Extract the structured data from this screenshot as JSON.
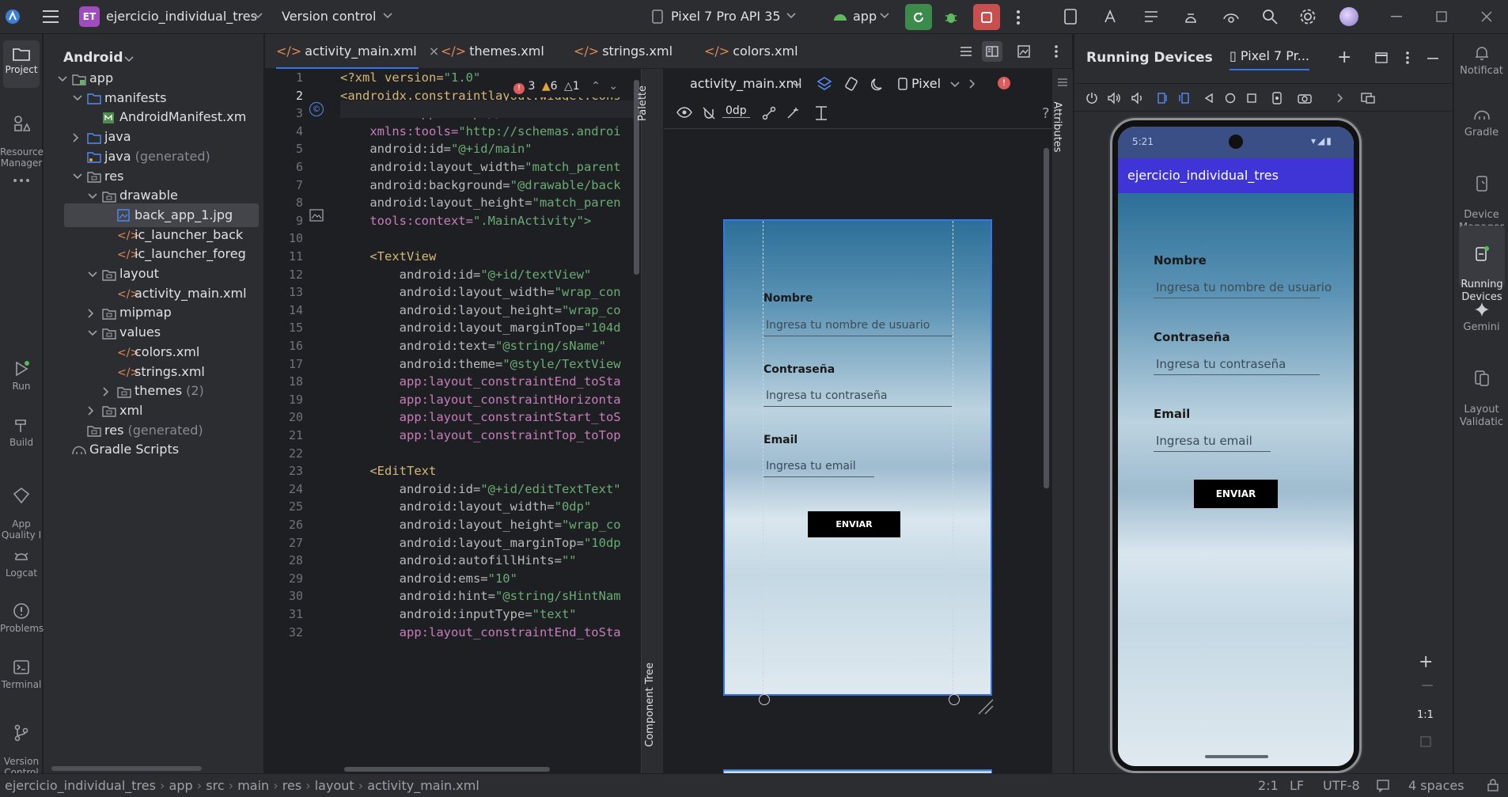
{
  "titlebar": {
    "project_badge": "ET",
    "project_name": "ejercicio_individual_tres",
    "vcs": "Version control",
    "device": "Pixel 7 Pro API 35",
    "run_config": "app"
  },
  "left_stripe": [
    {
      "label": "Project"
    },
    {
      "label": "Resource\nManager"
    },
    {
      "label": "Run"
    },
    {
      "label": "Build"
    },
    {
      "label": "App\nQuality I"
    },
    {
      "label": "Logcat"
    },
    {
      "label": "Problems"
    },
    {
      "label": "Terminal"
    },
    {
      "label": "Version\nControl"
    }
  ],
  "project_panel": {
    "view": "Android",
    "tree": [
      {
        "label": "app",
        "extra": ""
      },
      {
        "label": "manifests",
        "extra": ""
      },
      {
        "label": "AndroidManifest.xm",
        "extra": ""
      },
      {
        "label": "java",
        "extra": ""
      },
      {
        "label": "java",
        "extra": "(generated)"
      },
      {
        "label": "res",
        "extra": ""
      },
      {
        "label": "drawable",
        "extra": ""
      },
      {
        "label": "back_app_1.jpg",
        "extra": ""
      },
      {
        "label": "ic_launcher_back",
        "extra": ""
      },
      {
        "label": "ic_launcher_foreg",
        "extra": ""
      },
      {
        "label": "layout",
        "extra": ""
      },
      {
        "label": "activity_main.xml",
        "extra": ""
      },
      {
        "label": "mipmap",
        "extra": ""
      },
      {
        "label": "values",
        "extra": ""
      },
      {
        "label": "colors.xml",
        "extra": ""
      },
      {
        "label": "strings.xml",
        "extra": ""
      },
      {
        "label": "themes",
        "extra": "(2)"
      },
      {
        "label": "xml",
        "extra": ""
      },
      {
        "label": "res",
        "extra": "(generated)"
      },
      {
        "label": "Gradle Scripts",
        "extra": ""
      }
    ]
  },
  "tabs": [
    "activity_main.xml",
    "themes.xml",
    "strings.xml",
    "colors.xml"
  ],
  "inspections": {
    "errors": "3",
    "warnings": "6",
    "weak": "1"
  },
  "code_lines": [
    "1",
    "2",
    "3",
    "4",
    "5",
    "6",
    "7",
    "8",
    "9",
    "10",
    "11",
    "12",
    "13",
    "14",
    "15",
    "16",
    "17",
    "18",
    "19",
    "20",
    "21",
    "22",
    "23",
    "24",
    "25",
    "26",
    "27",
    "28",
    "29",
    "30",
    "31",
    "32"
  ],
  "code": [
    "<?xml version=\"1.0\" ",
    "<androidx.constraintlayout.widget.Cons",
    "    xmlns:app=\"http://schemas.android.",
    "    xmlns:tools=\"http://schemas.androi",
    "    android:id=\"@+id/main\"",
    "    android:layout_width=\"match_parent",
    "    android:background=\"@drawable/back",
    "    android:layout_height=\"match_paren",
    "    tools:context=\".MainActivity\">",
    "",
    "    <TextView",
    "        android:id=\"@+id/textView\"",
    "        android:layout_width=\"wrap_con",
    "        android:layout_height=\"wrap_co",
    "        android:layout_marginTop=\"104d",
    "        android:text=\"@string/sName\"",
    "        android:theme=\"@style/TextView",
    "        app:layout_constraintEnd_toSta",
    "        app:layout_constraintHorizonta",
    "        app:layout_constraintStart_toS",
    "        app:layout_constraintTop_toTop",
    "",
    "    <EditText",
    "        android:id=\"@+id/editTextText\"",
    "        android:layout_width=\"0dp\"",
    "        android:layout_height=\"wrap_co",
    "        android:layout_marginTop=\"10dp",
    "        android:autofillHints=\"\"",
    "        android:ems=\"10\"",
    "        android:hint=\"@string/sHintNam",
    "        android:inputType=\"text\"",
    "        app:layout_constraintEnd_toSta"
  ],
  "design": {
    "file": "activity_main.xml",
    "device": "Pixel",
    "margin": "0dp",
    "palette_label": "Palette",
    "component_tree_label": "Component Tree",
    "attributes_label": "Attributes",
    "form": {
      "name_label": "Nombre",
      "name_hint": "Ingresa tu nombre de usuario",
      "password_label": "Contraseña",
      "password_hint": "Ingresa tu contraseña",
      "email_label": "Email",
      "email_hint": "Ingresa tu email",
      "submit": "ENVIAR"
    }
  },
  "running_devices": {
    "title": "Running Devices",
    "device_tab": "Pixel 7 Pr...",
    "status_time": "5:21",
    "app_title": "ejercicio_individual_tres",
    "zoom": "1:1",
    "app_bar_color": "#3f35d6"
  },
  "right_stripe": [
    {
      "label": "Notificat"
    },
    {
      "label": "Gradle"
    },
    {
      "label": "Device\nManager"
    },
    {
      "label": "Running\nDevices"
    },
    {
      "label": "Gemini"
    },
    {
      "label": "Layout\nValidatic"
    }
  ],
  "statusbar": {
    "breadcrumb": [
      "ejercicio_individual_tres",
      "app",
      "src",
      "main",
      "res",
      "layout",
      "activity_main.xml"
    ],
    "position": "2:1",
    "line_sep": "LF",
    "encoding": "UTF-8",
    "indent": "4 spaces"
  }
}
